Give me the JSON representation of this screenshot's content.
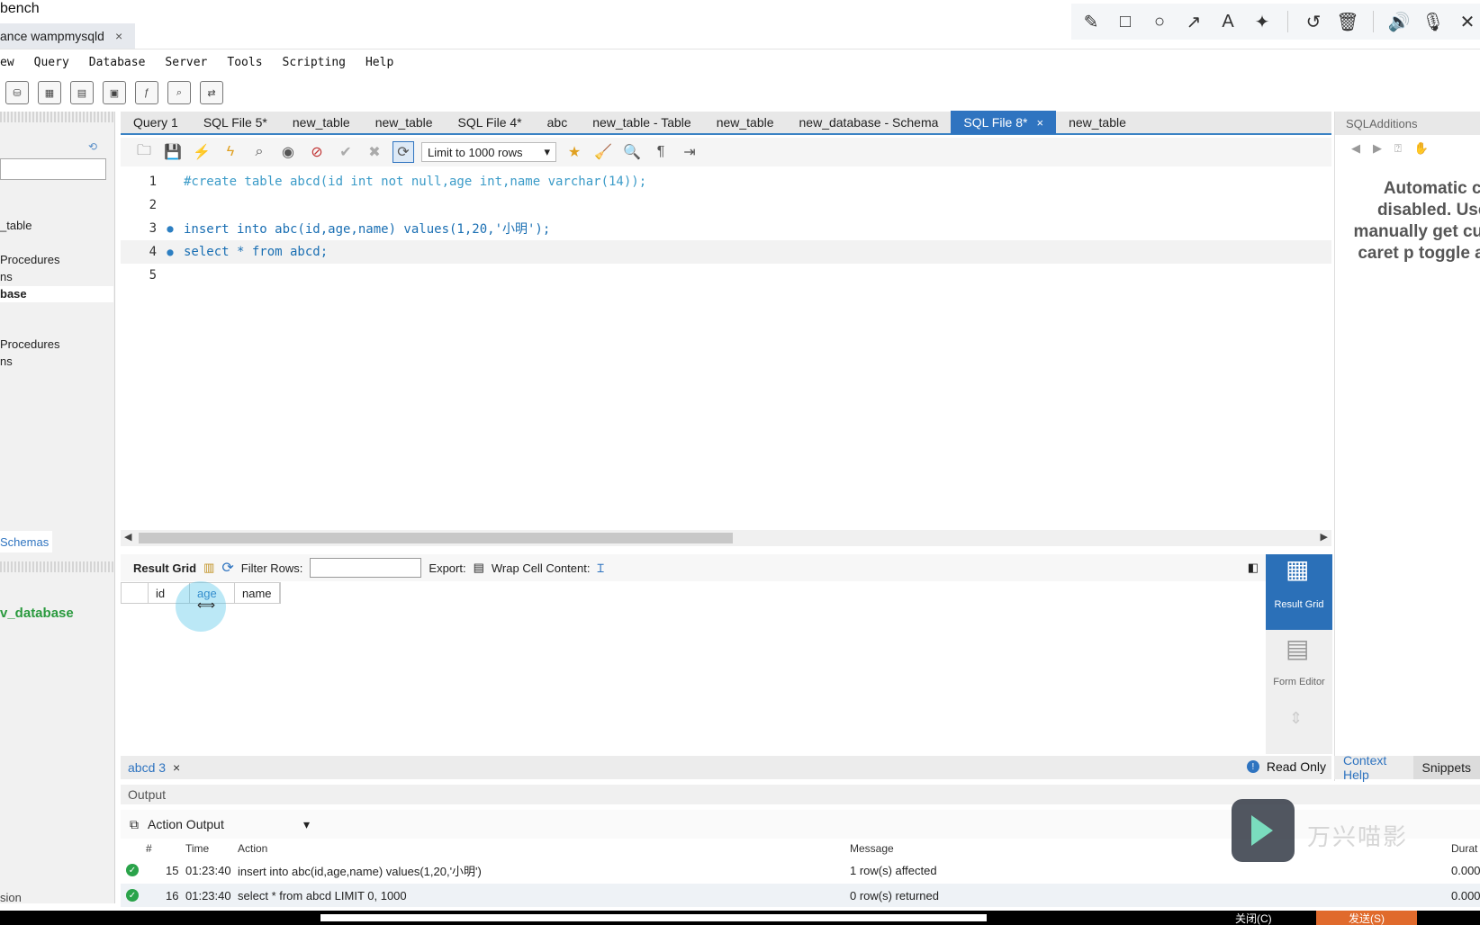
{
  "window": {
    "title": "bench",
    "connection_tab": "ance wampmysqld",
    "close_glyph": "×"
  },
  "annotation_toolbar": {
    "icons": [
      "pencil-icon",
      "rectangle-icon",
      "circle-icon",
      "arrow-icon",
      "text-icon",
      "magic-wand-icon",
      "undo-icon",
      "trash-icon",
      "speaker-icon",
      "microphone-icon",
      "close-icon"
    ],
    "glyphs": [
      "✎",
      "□",
      "○",
      "↗",
      "A",
      "✦",
      "↺",
      "🗑",
      "🔊",
      "🎙",
      "✕"
    ]
  },
  "menu": [
    "ew",
    "Query",
    "Database",
    "Server",
    "Tools",
    "Scripting",
    "Help"
  ],
  "sidebar": {
    "items": [
      {
        "label": "_table",
        "top": 0
      },
      {
        "label": "Procedures"
      },
      {
        "label": "ns"
      },
      {
        "label": "base"
      },
      {
        "label": "Procedures"
      },
      {
        "label": "ns"
      }
    ],
    "schemas_tab": "Schemas",
    "database": "v_database",
    "session_tab": "sion"
  },
  "editor_tabs": [
    {
      "label": "Query 1"
    },
    {
      "label": "SQL File 5*"
    },
    {
      "label": "new_table"
    },
    {
      "label": "new_table"
    },
    {
      "label": "SQL File 4*"
    },
    {
      "label": "abc"
    },
    {
      "label": "new_table - Table"
    },
    {
      "label": "new_table"
    },
    {
      "label": "new_database - Schema"
    },
    {
      "label": "SQL File 8*",
      "active": true
    },
    {
      "label": "new_table"
    }
  ],
  "editor_toolbar": {
    "limit": "Limit to 1000 rows"
  },
  "code_lines": [
    {
      "n": "1",
      "dot": "",
      "text": "#create table abcd(id int not null,age int,name varchar(14));"
    },
    {
      "n": "2",
      "dot": "",
      "text": ""
    },
    {
      "n": "3",
      "dot": "●",
      "text": "insert into abc(id,age,name) values(1,20,'小明');"
    },
    {
      "n": "4",
      "dot": "●",
      "text": "select * from abcd;"
    },
    {
      "n": "5",
      "dot": "",
      "text": ""
    }
  ],
  "result_toolbar": {
    "result_grid": "Result Grid",
    "filter_rows": "Filter Rows:",
    "filter_value": "",
    "export": "Export:",
    "wrap_cell": "Wrap Cell Content:"
  },
  "grid_columns": [
    "",
    "id",
    "age",
    "name"
  ],
  "right_buttons": {
    "result_grid": "Result Grid",
    "form_editor": "Form Editor"
  },
  "result_tabs": {
    "tab": "abcd 3",
    "read_only": "Read Only"
  },
  "sql_additions": {
    "title": "SQLAdditions",
    "help_text": "Automatic co disabled. Use t manually get current caret p toggle autor",
    "tabs": [
      "Context Help",
      "Snippets"
    ]
  },
  "output": {
    "header": "Output",
    "selector": "Action Output",
    "columns": [
      "#",
      "Time",
      "Action",
      "Message",
      "Durat"
    ],
    "rows": [
      {
        "num": "15",
        "time": "01:23:40",
        "action": "insert into abc(id,age,name) values(1,20,'小明')",
        "message": "1 row(s) affected",
        "duration": "0.000"
      },
      {
        "num": "16",
        "time": "01:23:40",
        "action": "select * from abcd LIMIT 0, 1000",
        "message": "0 row(s) returned",
        "duration": "0.000"
      }
    ]
  },
  "watermark": {
    "text": "万兴喵影"
  },
  "bottom": {
    "close_btn": "关闭(C)",
    "send_btn": "发送(S)"
  }
}
